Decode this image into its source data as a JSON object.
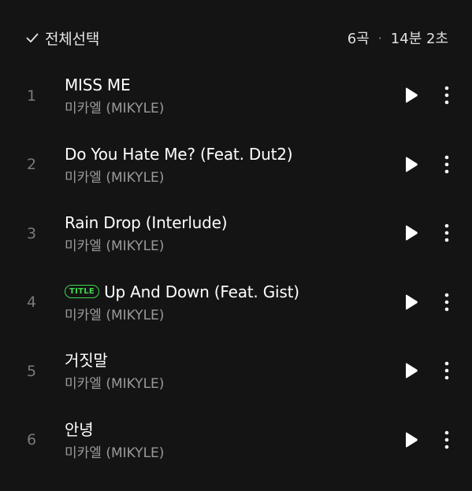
{
  "header": {
    "select_all_label": "전체선택",
    "track_count": "6곡",
    "separator": "·",
    "total_duration": "14분 2초"
  },
  "colors": {
    "background": "#141414",
    "title_badge": "#3fd64e"
  },
  "icons": {
    "check": "check-icon",
    "play": "play-icon",
    "more": "more-vertical-icon"
  },
  "tracks": [
    {
      "number": "1",
      "title": "MISS ME",
      "artist": "미카엘 (MIKYLE)",
      "badge": ""
    },
    {
      "number": "2",
      "title": "Do You Hate Me? (Feat. Dut2)",
      "artist": "미카엘 (MIKYLE)",
      "badge": ""
    },
    {
      "number": "3",
      "title": "Rain Drop (Interlude)",
      "artist": "미카엘 (MIKYLE)",
      "badge": ""
    },
    {
      "number": "4",
      "title": "Up And Down (Feat. Gist)",
      "artist": "미카엘 (MIKYLE)",
      "badge": "TITLE"
    },
    {
      "number": "5",
      "title": "거짓말",
      "artist": "미카엘 (MIKYLE)",
      "badge": ""
    },
    {
      "number": "6",
      "title": "안녕",
      "artist": "미카엘 (MIKYLE)",
      "badge": ""
    }
  ]
}
